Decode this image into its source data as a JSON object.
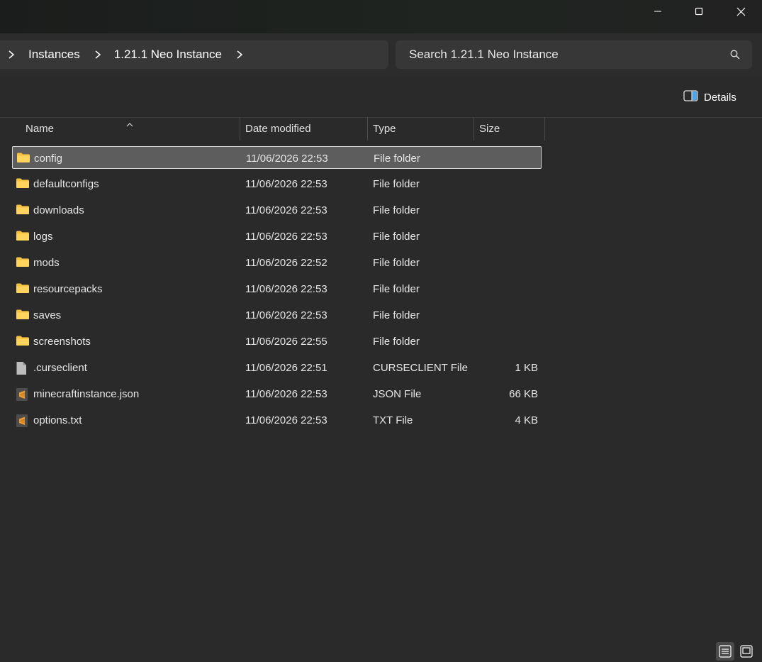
{
  "window": {
    "minimize_icon": "minimize-icon",
    "maximize_icon": "maximize-icon",
    "close_icon": "close-icon"
  },
  "address": {
    "crumbs": [
      "Instances",
      "1.21.1 Neo Instance"
    ],
    "search_placeholder": "Search 1.21.1 Neo Instance"
  },
  "commandbar": {
    "details_label": "Details"
  },
  "columns": {
    "name": "Name",
    "date": "Date modified",
    "type": "Type",
    "size": "Size"
  },
  "files": [
    {
      "name": "config",
      "date": "11/06/2026 22:53",
      "type": "File folder",
      "size": "",
      "icon": "folder-icon",
      "selected": true
    },
    {
      "name": "defaultconfigs",
      "date": "11/06/2026 22:53",
      "type": "File folder",
      "size": "",
      "icon": "folder-icon"
    },
    {
      "name": "downloads",
      "date": "11/06/2026 22:53",
      "type": "File folder",
      "size": "",
      "icon": "folder-icon"
    },
    {
      "name": "logs",
      "date": "11/06/2026 22:53",
      "type": "File folder",
      "size": "",
      "icon": "folder-icon"
    },
    {
      "name": "mods",
      "date": "11/06/2026 22:52",
      "type": "File folder",
      "size": "",
      "icon": "folder-icon"
    },
    {
      "name": "resourcepacks",
      "date": "11/06/2026 22:53",
      "type": "File folder",
      "size": "",
      "icon": "folder-icon"
    },
    {
      "name": "saves",
      "date": "11/06/2026 22:53",
      "type": "File folder",
      "size": "",
      "icon": "folder-icon"
    },
    {
      "name": "screenshots",
      "date": "11/06/2026 22:55",
      "type": "File folder",
      "size": "",
      "icon": "folder-icon"
    },
    {
      "name": ".curseclient",
      "date": "11/06/2026 22:51",
      "type": "CURSECLIENT File",
      "size": "1 KB",
      "icon": "generic-file-icon"
    },
    {
      "name": "minecraftinstance.json",
      "date": "11/06/2026 22:53",
      "type": "JSON File",
      "size": "66 KB",
      "icon": "sublime-file-icon"
    },
    {
      "name": "options.txt",
      "date": "11/06/2026 22:53",
      "type": "TXT File",
      "size": "4 KB",
      "icon": "sublime-file-icon"
    }
  ],
  "colors": {
    "background": "#2a2a2a",
    "folder": "#f5c242",
    "sublime": "#f59b2a",
    "selection": "#5d5d5d"
  }
}
